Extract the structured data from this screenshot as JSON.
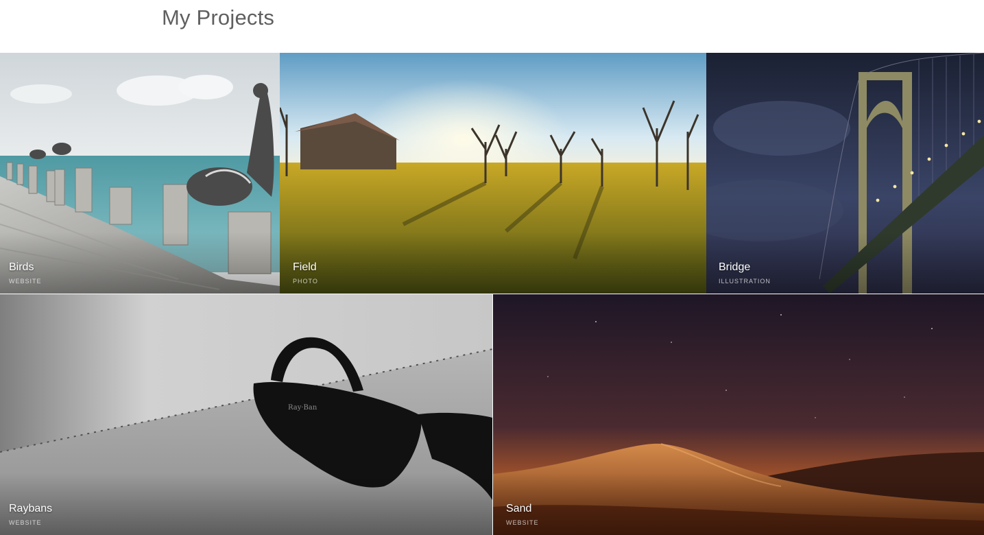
{
  "header": {
    "title": "My Projects"
  },
  "projects": [
    {
      "title": "Birds",
      "category": "WEBSITE"
    },
    {
      "title": "Field",
      "category": "PHOTO"
    },
    {
      "title": "Bridge",
      "category": "ILLUSTRATION"
    },
    {
      "title": "Raybans",
      "category": "WEBSITE"
    },
    {
      "title": "Sand",
      "category": "WEBSITE"
    }
  ],
  "colors": {
    "title_text": "#5f5f5f",
    "caption_text": "#ffffff"
  }
}
